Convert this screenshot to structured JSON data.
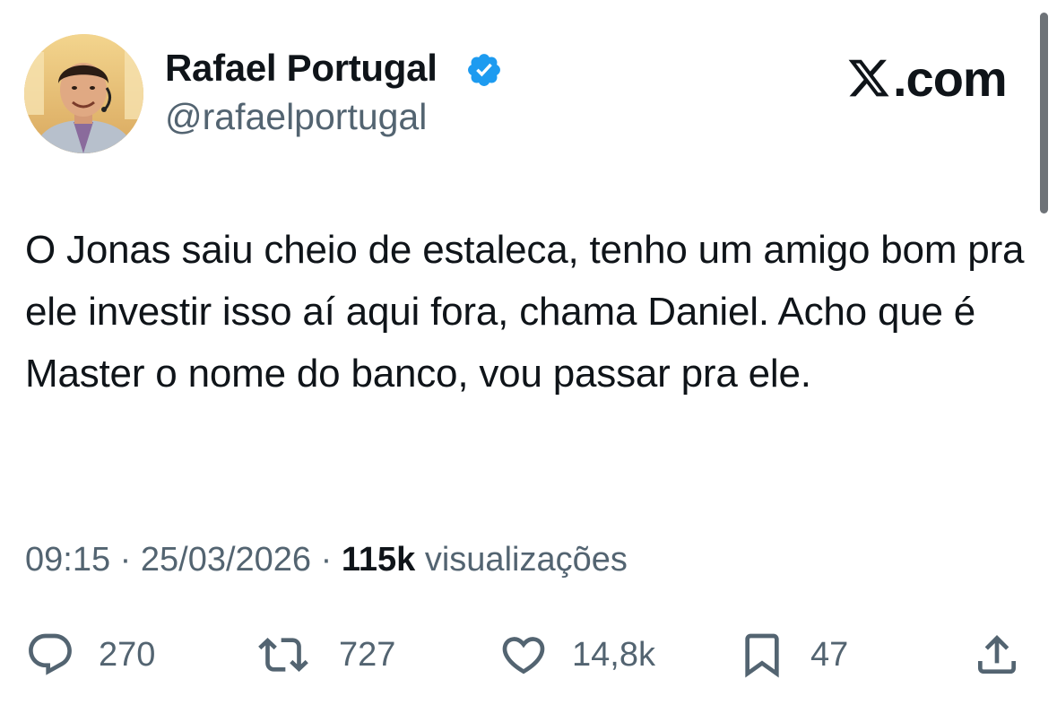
{
  "author": {
    "name": "Rafael Portugal",
    "handle": "@rafaelportugal",
    "verified_icon": "verified-badge-icon",
    "verified_color": "#1d9bf0"
  },
  "brand": {
    "text": ".com",
    "icon": "x-logo-icon"
  },
  "tweet": {
    "text": "O Jonas saiu cheio de estaleca, tenho um amigo bom pra ele investir isso aí aqui fora, chama Daniel. Acho que é Master o nome do banco, vou passar pra ele."
  },
  "meta": {
    "time": "09:15",
    "separator": " · ",
    "date": "25/03/2026",
    "views_count": "115k",
    "views_label": " visualizações"
  },
  "actions": {
    "replies": {
      "icon": "reply-icon",
      "count": "270"
    },
    "retweets": {
      "icon": "retweet-icon",
      "count": "727"
    },
    "likes": {
      "icon": "heart-icon",
      "count": "14,8k"
    },
    "bookmarks": {
      "icon": "bookmark-icon",
      "count": "47"
    },
    "share": {
      "icon": "share-icon"
    }
  },
  "colors": {
    "text": "#0f1419",
    "secondary": "#536471",
    "verified": "#1d9bf0"
  }
}
